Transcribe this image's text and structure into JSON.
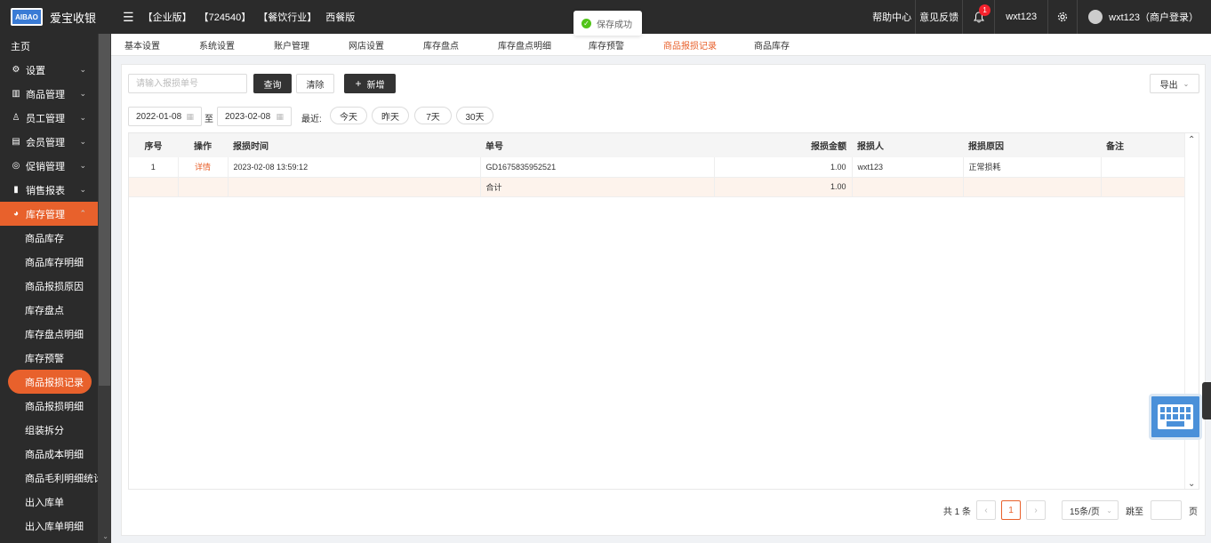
{
  "app": {
    "brand": "爱宝收银",
    "logo_text": "AIBAO",
    "edition": "【企业版】",
    "store_id": "【724540】",
    "industry": "【餐饮行业】",
    "cuisine": "西餐版"
  },
  "topbar": {
    "help": "帮助中心",
    "feedback": "意见反馈",
    "notify_count": "1",
    "user_short": "wxt123",
    "account": "wxt123（商户登录）"
  },
  "toast": {
    "message": "保存成功"
  },
  "sidebar": {
    "home": "主页",
    "groups": [
      {
        "label": "设置",
        "icon": "gear-icon"
      },
      {
        "label": "商品管理",
        "icon": "barcode-icon"
      },
      {
        "label": "员工管理",
        "icon": "user-icon"
      },
      {
        "label": "会员管理",
        "icon": "member-card-icon"
      },
      {
        "label": "促销管理",
        "icon": "check-circle-icon"
      },
      {
        "label": "销售报表",
        "icon": "bar-chart-icon"
      },
      {
        "label": "库存管理",
        "icon": "pie-chart-icon"
      }
    ],
    "sub_items": [
      "商品库存",
      "商品库存明细",
      "商品报损原因",
      "库存盘点",
      "库存盘点明细",
      "库存预警",
      "商品报损记录",
      "商品报损明细",
      "组装拆分",
      "商品成本明细",
      "商品毛利明细统计",
      "出入库单",
      "出入库单明细"
    ]
  },
  "tabs": [
    "基本设置",
    "系统设置",
    "账户管理",
    "网店设置",
    "库存盘点",
    "库存盘点明细",
    "库存预警",
    "商品报损记录",
    "商品库存"
  ],
  "filters": {
    "search_placeholder": "请输入报损单号",
    "query": "查询",
    "clear": "清除",
    "add": "新增",
    "export": "导出",
    "date_from": "2022-01-08",
    "to_label": "至",
    "date_to": "2023-02-08",
    "recent_label": "最近:",
    "quick": [
      "今天",
      "昨天",
      "7天",
      "30天"
    ]
  },
  "table": {
    "headers": [
      "序号",
      "操作",
      "报损时间",
      "单号",
      "报损金额",
      "报损人",
      "报损原因",
      "备注"
    ],
    "rows": [
      {
        "no": "1",
        "action": "详情",
        "time": "2023-02-08 13:59:12",
        "order": "GD1675835952521",
        "amount": "1.00",
        "person": "wxt123",
        "reason": "正常损耗",
        "note": ""
      }
    ],
    "summary": {
      "label": "合计",
      "amount": "1.00"
    }
  },
  "pager": {
    "total": "共 1 条",
    "current": "1",
    "page_size": "15条/页",
    "jump_label": "跳至",
    "page_unit": "页"
  }
}
